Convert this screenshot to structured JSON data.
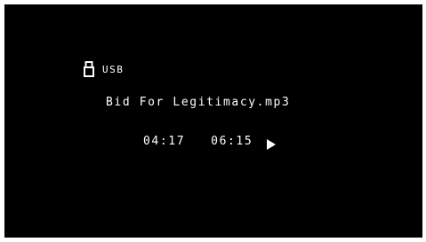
{
  "colors": {
    "background": "#000000",
    "foreground": "#ffffff",
    "frame": "#ffffff"
  },
  "source": {
    "icon": "usb-icon",
    "label": "USB"
  },
  "track": {
    "title": "Bid For Legitimacy.mp3"
  },
  "playback": {
    "elapsed": "04:17",
    "total": "06:15",
    "state_icon": "play-icon"
  }
}
